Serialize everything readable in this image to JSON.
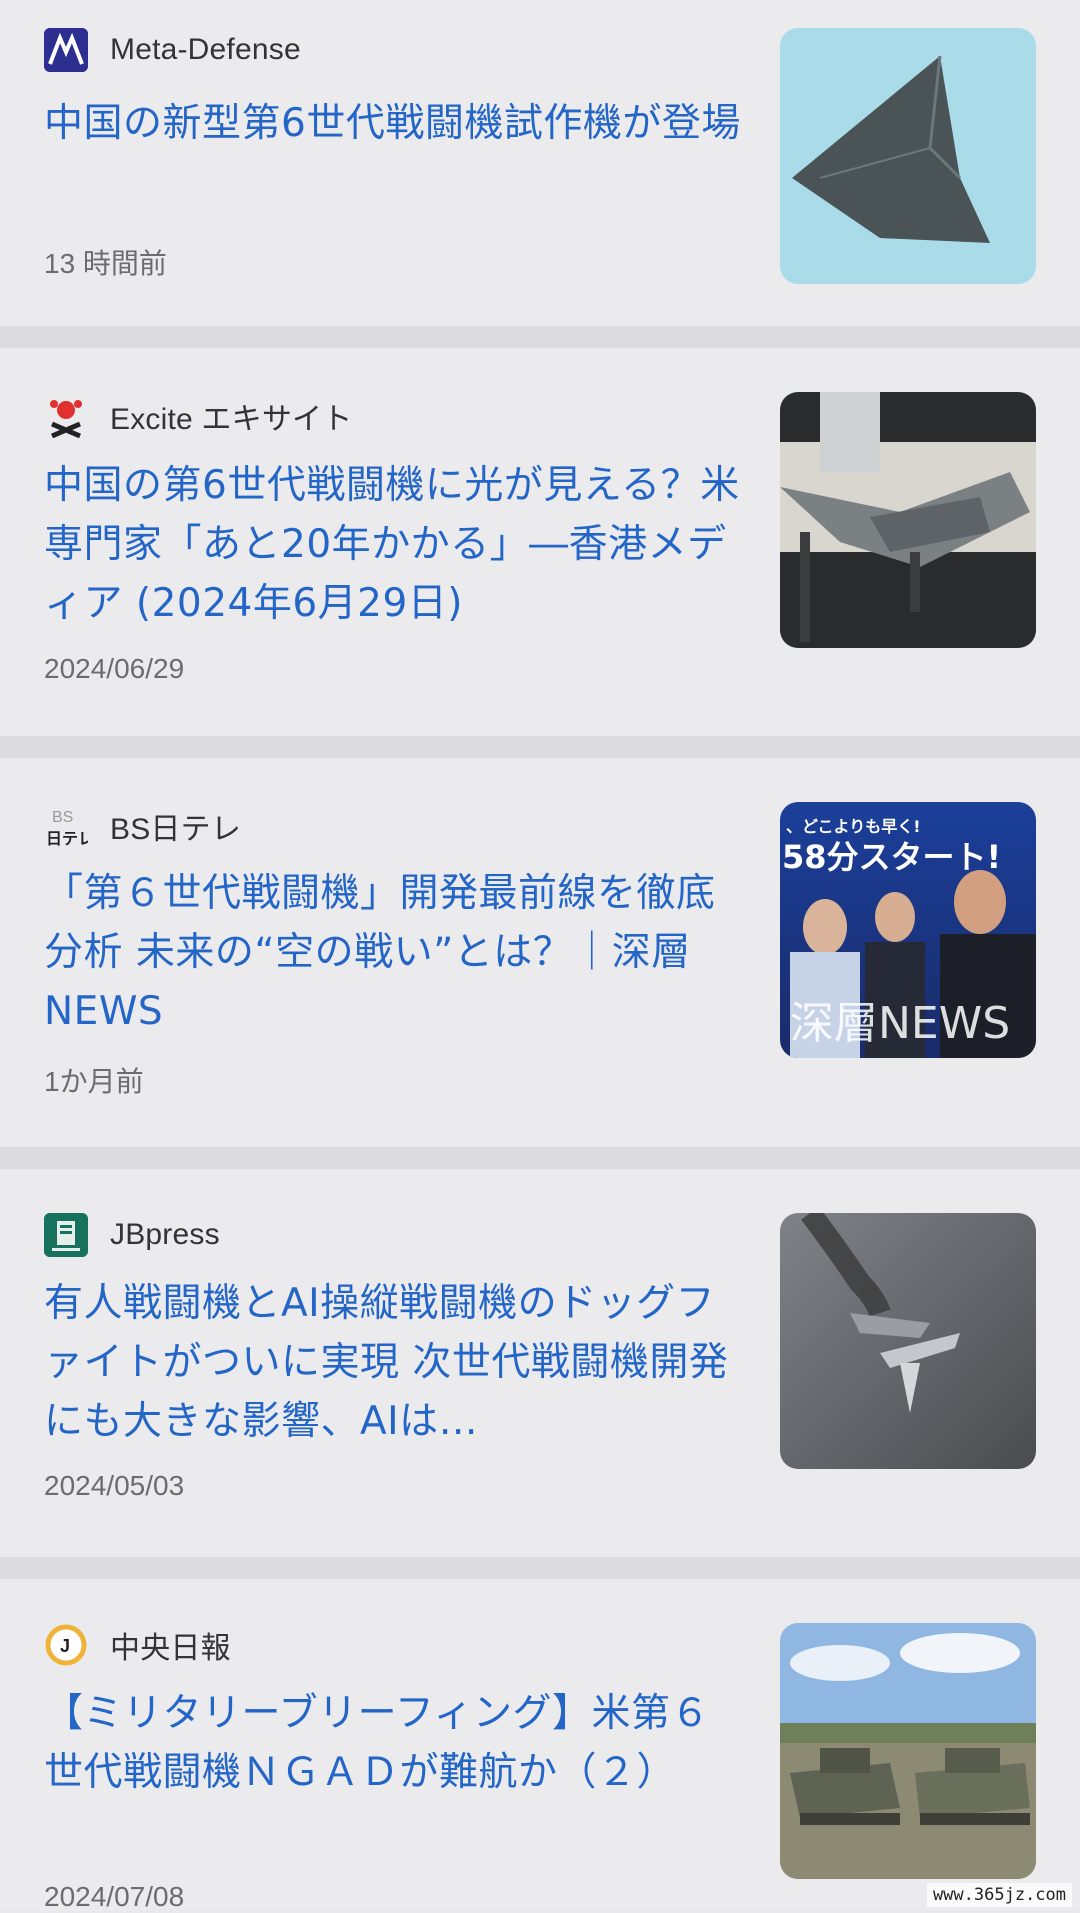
{
  "articles": [
    {
      "source": "Meta-Defense",
      "headline": "中国の新型第6世代戦闘機試作機が登場",
      "time": "13 時間前",
      "logo_icon": "meta-defense-logo-icon",
      "thumb_desc": "stealth-jet-thumbnail"
    },
    {
      "source": "Excite エキサイト",
      "headline": "中国の第6世代戦闘機に光が見える？米専門家「あと20年かかる」―香港メディア (2024年6月29日)",
      "time": "2024/06/29",
      "logo_icon": "excite-logo-icon",
      "thumb_desc": "fighter-model-thumbnail"
    },
    {
      "source": "BS日テレ",
      "headline": "「第６世代戦闘機」開発最前線を徹底分析 未来の“空の戦い”とは？｜深層NEWS",
      "time": "1か月前",
      "logo_icon": "bs-nittele-logo-icon",
      "thumb_desc": "news-anchors-thumbnail",
      "thumb_text_top": "、どこよりも早く!",
      "thumb_text_mid": "58分スタート!",
      "thumb_text_bottom": "深層NEWS"
    },
    {
      "source": "JBpress",
      "headline": "有人戦闘機とAI操縦戦闘機のドッグファイトがついに実現 次世代戦闘機開発にも大きな影響、AIは…",
      "time": "2024/05/03",
      "logo_icon": "jbpress-logo-icon",
      "thumb_desc": "dogfight-jets-thumbnail"
    },
    {
      "source": "中央日報",
      "headline": "【ミリタリーブリーフィング】米第６世代戦闘機ＮＧＡＤが難航か（２）",
      "time": "2024/07/08",
      "logo_icon": "joongang-logo-icon",
      "thumb_desc": "tanks-field-thumbnail"
    }
  ],
  "watermark": "www.365jz.com",
  "colors": {
    "headline": "#2465c8",
    "background": "#ebebed",
    "divider": "#dcdce0",
    "time": "#6c6c70"
  }
}
